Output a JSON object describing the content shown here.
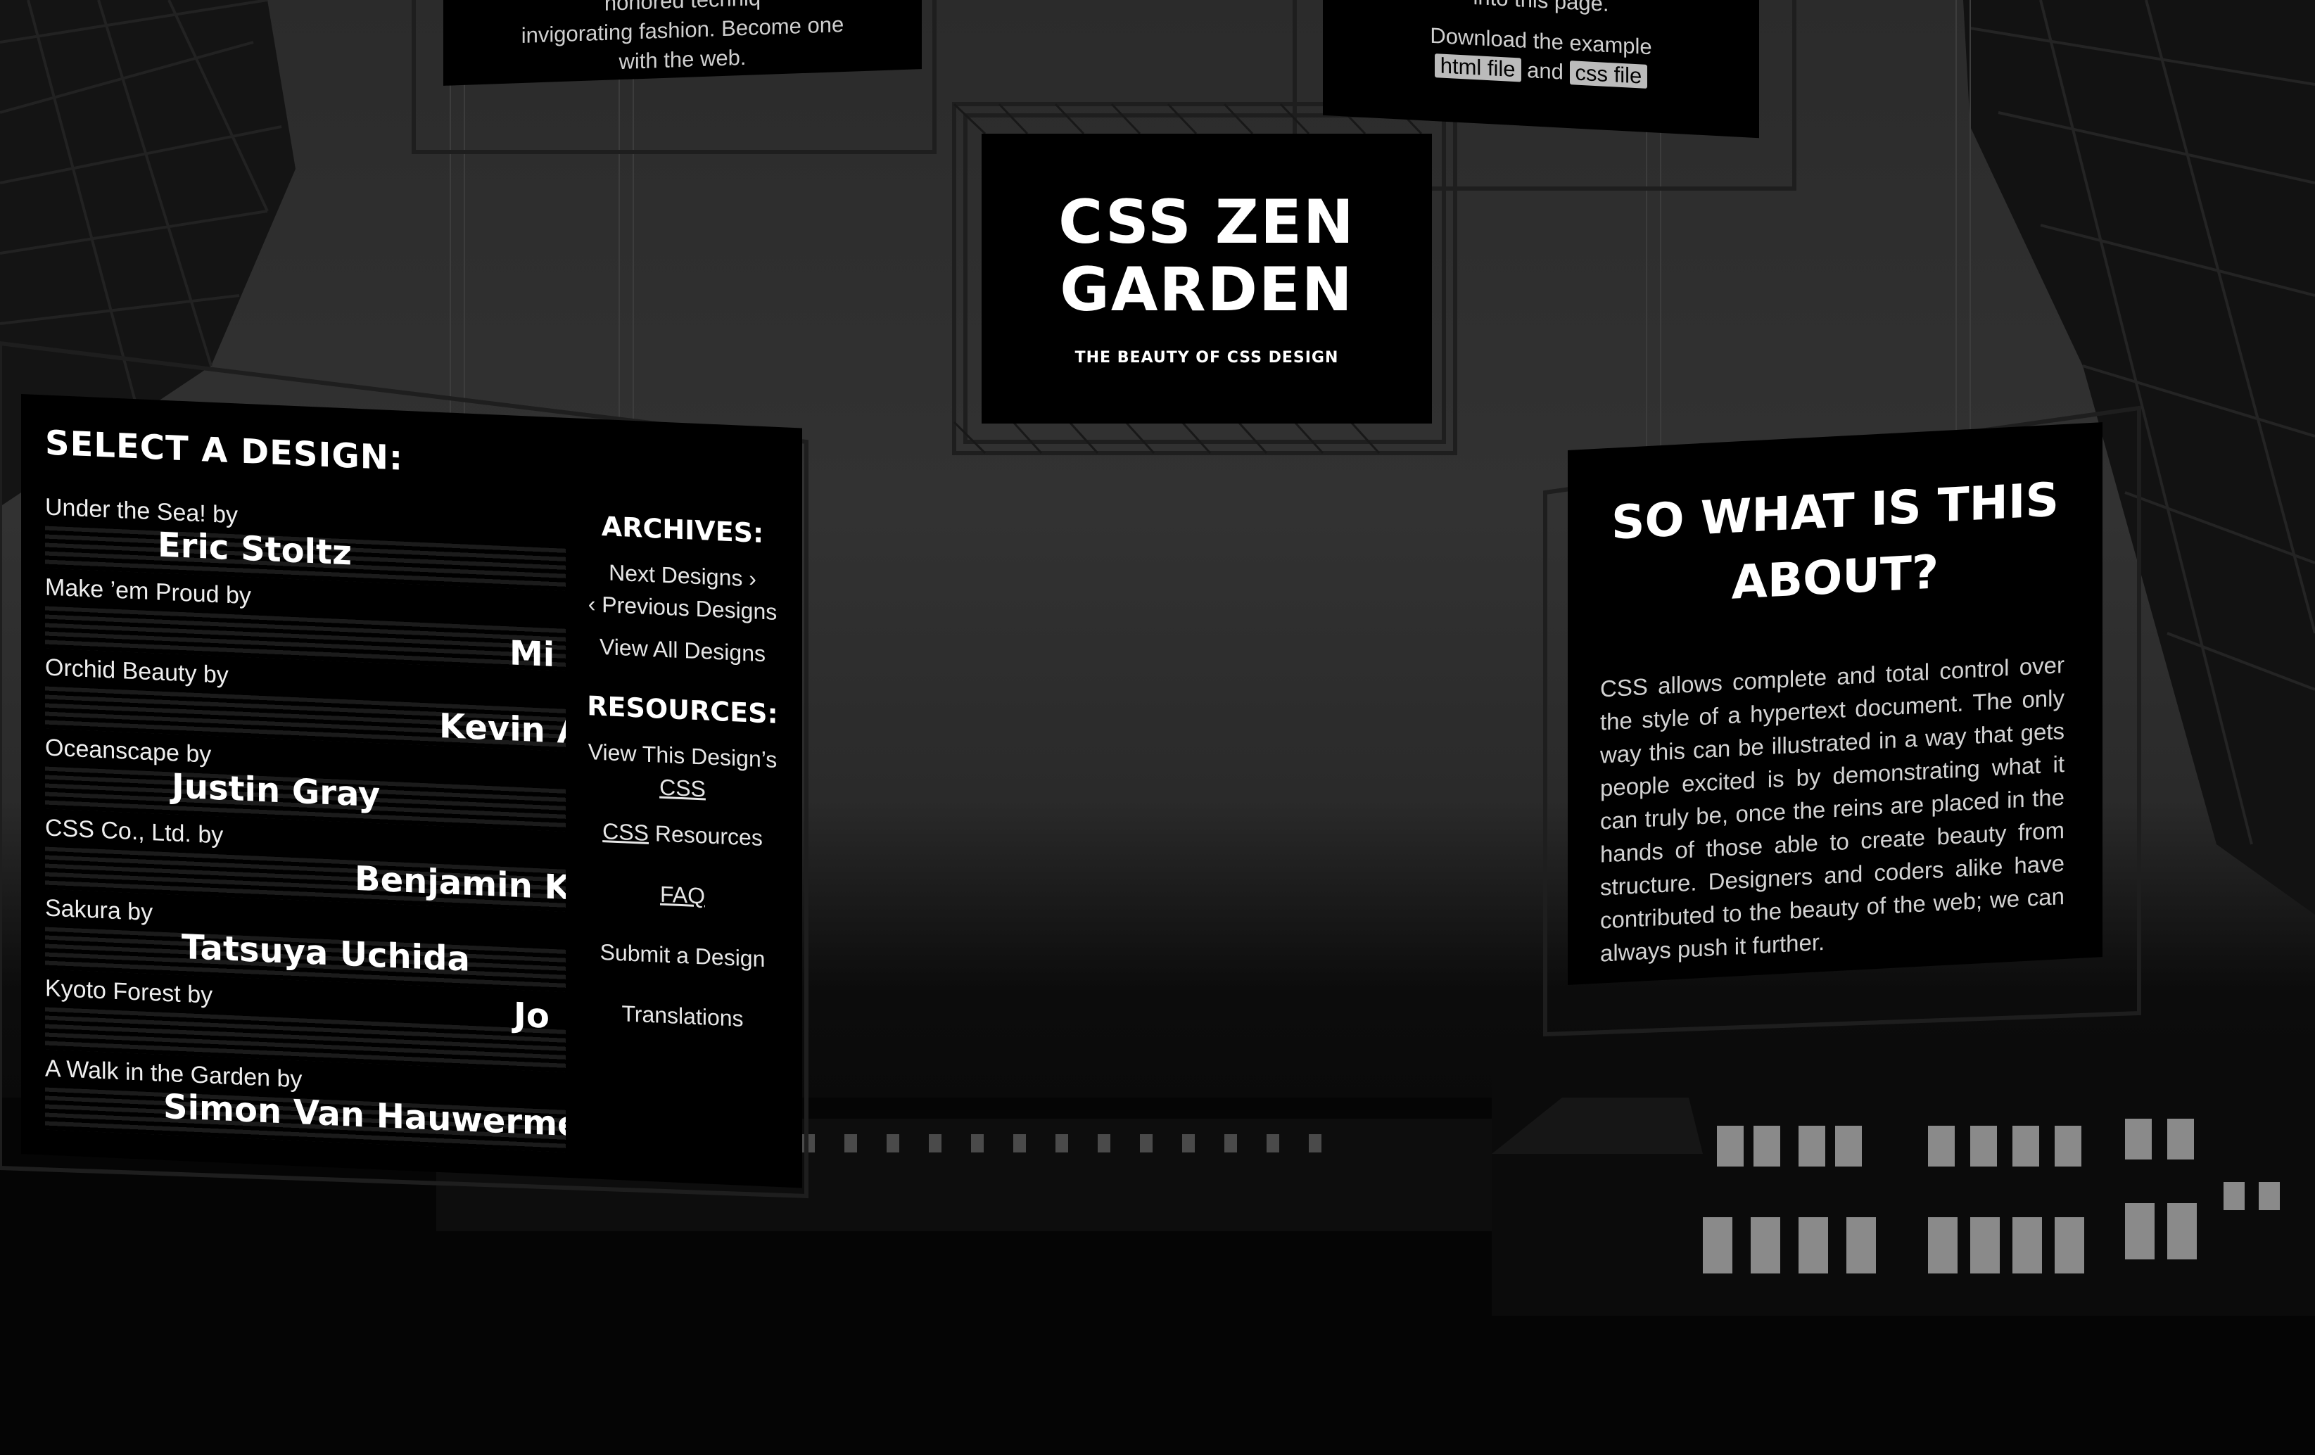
{
  "header": {
    "title_line1": "CSS ZEN",
    "title_line2": "GARDEN",
    "tagline": "THE BEAUTY OF CSS DESIGN"
  },
  "intro": {
    "line1": "honored techniq",
    "line2": "invigorating fashion. Become one",
    "line3": "with the web."
  },
  "download": {
    "line1": "into this page.",
    "line2": "Download the example",
    "html_link": "html file",
    "and": "and",
    "css_link": "css file"
  },
  "designs": {
    "heading": "SELECT A DESIGN:",
    "items": [
      {
        "name": "Under the Sea! by",
        "author": "Eric Stoltz"
      },
      {
        "name": "Make ’em Proud by",
        "author": "Mi"
      },
      {
        "name": "Orchid Beauty by",
        "author": "Kevin A"
      },
      {
        "name": "Oceanscape by",
        "author": "Justin Gray"
      },
      {
        "name": "CSS Co., Ltd. by",
        "author": "Benjamin Kle"
      },
      {
        "name": "Sakura by",
        "author": "Tatsuya Uchida"
      },
      {
        "name": "Kyoto Forest by",
        "author": "Jo"
      },
      {
        "name": "A Walk in the Garden by",
        "author": "Simon Van Hauwermeiren"
      }
    ]
  },
  "sidebar": {
    "archives_heading": "ARCHIVES:",
    "next_designs": "Next Designs ›",
    "previous_designs": "‹ Previous Designs",
    "view_all": "View All Designs",
    "resources_heading": "RESOURCES:",
    "view_css_line1": "View This Design’s",
    "view_css_line2": "CSS",
    "css_resources_abbr": "CSS",
    "css_resources_rest": " Resources",
    "faq": "FAQ",
    "submit": "Submit a Design",
    "translations": "Translations"
  },
  "about": {
    "title_line1": "SO WHAT IS THIS",
    "title_line2": "ABOUT?",
    "body": "CSS allows complete and total control over the style of a hypertext document. The only way this can be illustrated in a way that gets people excited is by demonstrating what it can truly be, once the reins are placed in the hands of those able to create beauty from structure. Designers and coders alike have contributed to the beauty of the web; we can always push it further."
  },
  "colors": {
    "background_top": "#2b2b2b",
    "panel": "#000000",
    "text": "#ffffff",
    "highlight": "#bbbbbb"
  }
}
